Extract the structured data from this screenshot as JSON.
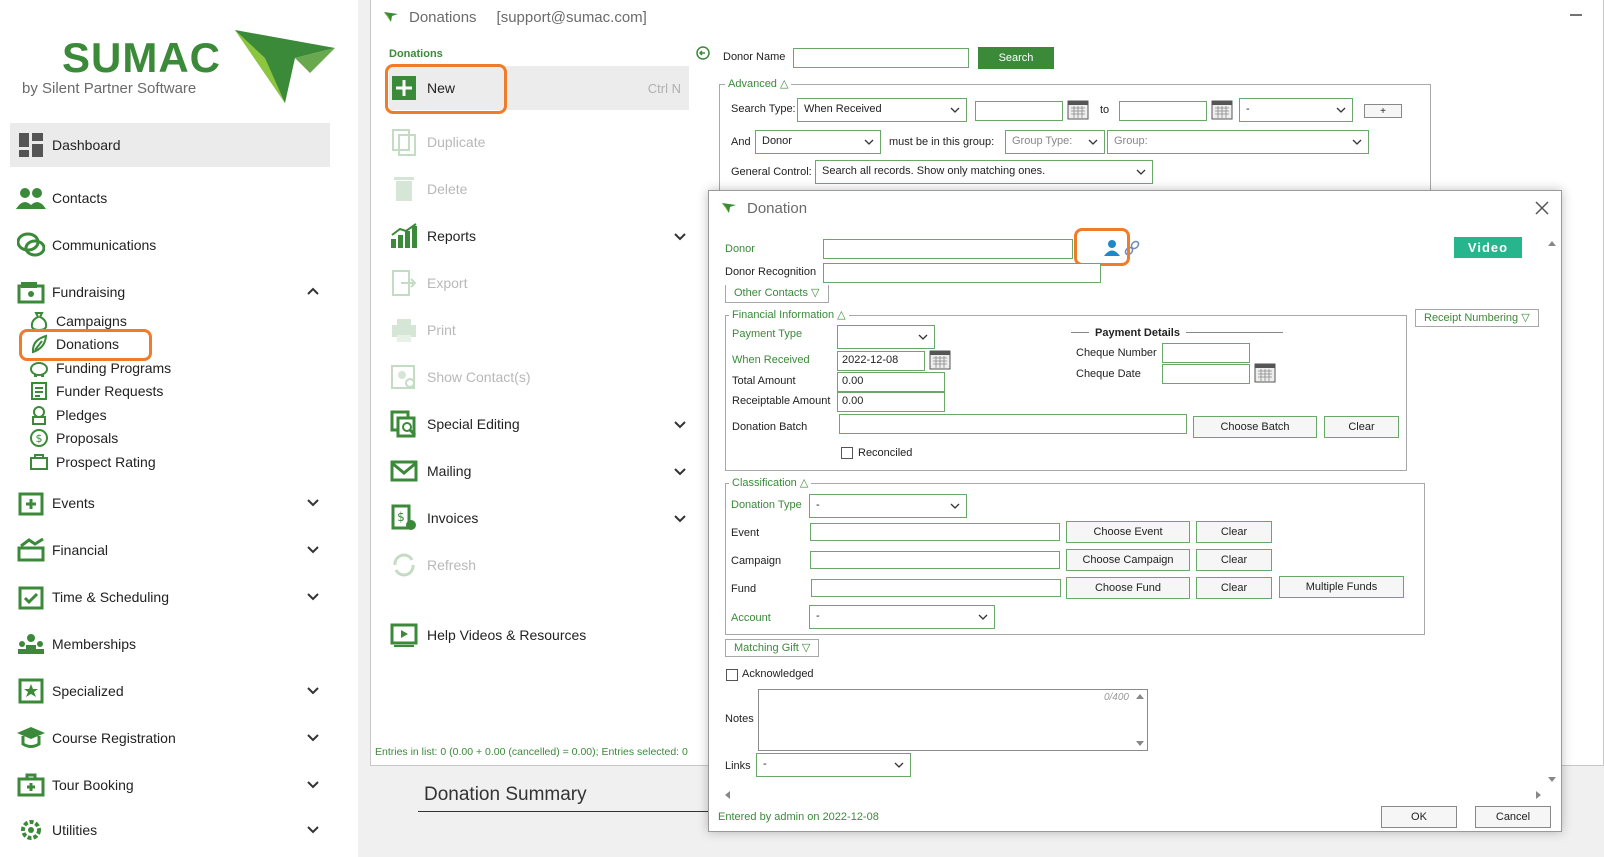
{
  "sidebar": {
    "logo": {
      "name": "SUMAC",
      "byline": "by Silent Partner Software"
    },
    "items": [
      {
        "label": "Dashboard"
      },
      {
        "label": "Contacts"
      },
      {
        "label": "Communications"
      },
      {
        "label": "Fundraising"
      },
      {
        "label": "Events"
      },
      {
        "label": "Financial"
      },
      {
        "label": "Time & Scheduling"
      },
      {
        "label": "Memberships"
      },
      {
        "label": "Specialized"
      },
      {
        "label": "Course Registration"
      },
      {
        "label": "Tour Booking"
      },
      {
        "label": "Utilities"
      }
    ],
    "fundraising_sub": [
      {
        "label": "Campaigns"
      },
      {
        "label": "Donations"
      },
      {
        "label": "Funding Programs"
      },
      {
        "label": "Funder Requests"
      },
      {
        "label": "Pledges"
      },
      {
        "label": "Proposals"
      },
      {
        "label": "Prospect Rating"
      }
    ]
  },
  "donations_window": {
    "title": "Donations",
    "account": "[support@sumac.com]",
    "actions_header": "Donations",
    "actions": {
      "new": "New",
      "new_shortcut": "Ctrl N",
      "duplicate": "Duplicate",
      "delete": "Delete",
      "reports": "Reports",
      "export": "Export",
      "print": "Print",
      "show_contacts": "Show Contact(s)",
      "special_editing": "Special Editing",
      "mailing": "Mailing",
      "invoices": "Invoices",
      "refresh": "Refresh",
      "help": "Help Videos & Resources"
    },
    "status": "Entries in list: 0 (0.00 + 0.00 (cancelled) = 0.00); Entries selected: 0",
    "search": {
      "donor_name_label": "Donor Name",
      "search_button": "Search",
      "advanced_label": "Advanced △",
      "search_type_label": "Search Type:",
      "search_type_value": "When Received",
      "to_label": "to",
      "range_select_value": "-",
      "plus_button": "+",
      "and_label": "And",
      "and_value": "Donor",
      "must_be_label": "must be in this group:",
      "group_type_placeholder": "Group Type:",
      "group_placeholder": "Group:",
      "general_control_label": "General Control:",
      "general_control_value": "Search all records. Show only matching ones."
    },
    "summary_title": "Donation Summary"
  },
  "dialog": {
    "title": "Donation",
    "donor_label": "Donor",
    "donor_recognition_label": "Donor Recognition",
    "video_button": "Video",
    "other_contacts": "Other Contacts ▽",
    "receipt_numbering": "Receipt Numbering ▽",
    "financial": {
      "title": "Financial Information △",
      "payment_type_label": "Payment Type",
      "when_received_label": "When Received",
      "when_received_value": "2022-12-08",
      "total_amount_label": "Total Amount",
      "total_amount_value": "0.00",
      "receiptable_label": "Receiptable Amount",
      "receiptable_value": "0.00",
      "batch_label": "Donation Batch",
      "choose_batch": "Choose Batch",
      "clear": "Clear",
      "reconciled": "Reconciled",
      "payment_details": "Payment Details",
      "cheque_number_label": "Cheque Number",
      "cheque_date_label": "Cheque Date"
    },
    "classification": {
      "title": "Classification △",
      "donation_type_label": "Donation Type",
      "donation_type_value": "-",
      "event_label": "Event",
      "choose_event": "Choose Event",
      "campaign_label": "Campaign",
      "choose_campaign": "Choose Campaign",
      "fund_label": "Fund",
      "choose_fund": "Choose Fund",
      "multiple_funds": "Multiple Funds",
      "clear": "Clear",
      "account_label": "Account",
      "account_value": "-"
    },
    "matching_gift": "Matching Gift ▽",
    "acknowledged": "Acknowledged",
    "notes_label": "Notes",
    "notes_counter": "0/400",
    "links_label": "Links",
    "links_value": "-",
    "entered_by": "Entered by admin on 2022-12-08",
    "ok": "OK",
    "cancel": "Cancel"
  },
  "colors": {
    "brand_green": "#3b8a3a",
    "highlight_orange": "#f07c2a",
    "video_teal": "#26b58c"
  }
}
